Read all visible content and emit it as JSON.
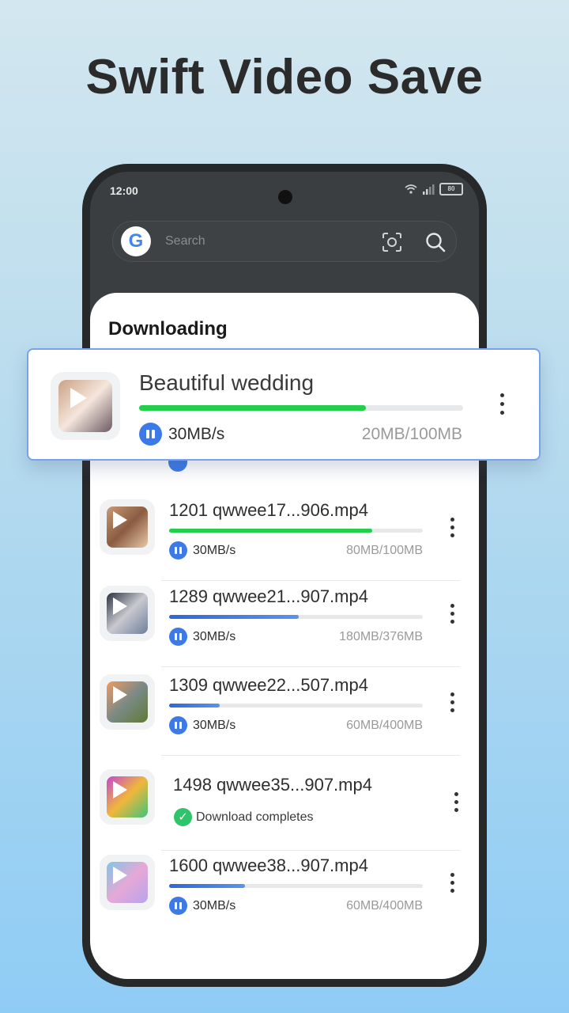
{
  "headline": "Swift Video Save",
  "status_bar": {
    "time": "12:00",
    "battery": "80"
  },
  "search": {
    "logo": "G",
    "placeholder": "Search"
  },
  "sheet": {
    "title": "Downloading"
  },
  "featured": {
    "name": "Beautiful wedding",
    "speed": "30MB/s",
    "size": "20MB/100MB",
    "progress": 0.7,
    "bar_color": "green",
    "thumb_colors": [
      "#caa184",
      "#f5e6dc",
      "#6b5a63"
    ]
  },
  "downloads": [
    {
      "name": "1201 qwwee17...906.mp4",
      "speed": "30MB/s",
      "size": "80MB/100MB",
      "progress": 0.8,
      "bar_color": "green",
      "status": "downloading",
      "thumb_colors": [
        "#c99a74",
        "#8a5c42",
        "#e9c7a7"
      ]
    },
    {
      "name": "1289 qwwee21...907.mp4",
      "speed": "30MB/s",
      "size": "180MB/376MB",
      "progress": 0.51,
      "bar_color": "blue",
      "status": "downloading",
      "thumb_colors": [
        "#2a3140",
        "#c9c9cf",
        "#6e7f9c"
      ]
    },
    {
      "name": "1309 qwwee22...507.mp4",
      "speed": "30MB/s",
      "size": "60MB/400MB",
      "progress": 0.2,
      "bar_color": "blue",
      "status": "downloading",
      "thumb_colors": [
        "#ef9a64",
        "#7b8a86",
        "#5f7a35"
      ]
    },
    {
      "name": "1498 qwwee35...907.mp4",
      "status": "complete",
      "status_text": "Download completes",
      "thumb_colors": [
        "#c646d0",
        "#f0b73a",
        "#3fc47a"
      ]
    },
    {
      "name": "1600 qwwee38...907.mp4",
      "speed": "30MB/s",
      "size": "60MB/400MB",
      "progress": 0.3,
      "bar_color": "blue",
      "status": "downloading",
      "thumb_colors": [
        "#7fc6e6",
        "#e6a8d6",
        "#b7a4ec"
      ]
    }
  ],
  "colors": {
    "accent_blue": "#3d7ae8",
    "progress_green": "#21cf4a",
    "complete_green": "#2ec46a",
    "card_border": "#7aa2ea"
  }
}
